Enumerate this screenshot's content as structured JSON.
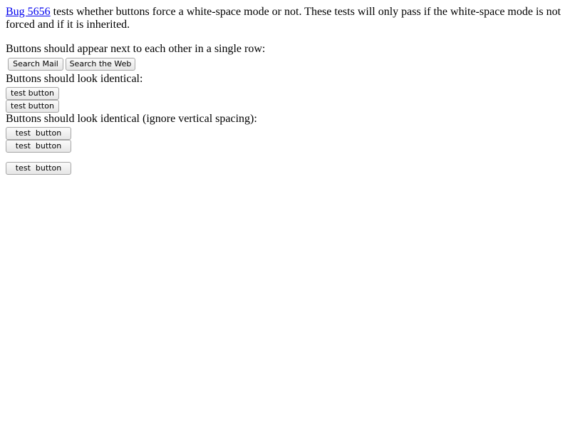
{
  "intro": {
    "link_text": "Bug 5656",
    "text": " tests whether buttons force a white-space mode or not. These tests will only pass if the white-space mode is not forced and if it is inherited."
  },
  "section1": {
    "label": "Buttons should appear next to each other in a single row:",
    "buttons": [
      "Search Mail",
      "Search the Web"
    ]
  },
  "section2": {
    "label": "Buttons should look identical:",
    "buttons": [
      "test button",
      "test button"
    ]
  },
  "section3": {
    "label": "Buttons should look identical (ignore vertical spacing):",
    "buttons": [
      "test  button",
      "test  button",
      "test  button"
    ]
  }
}
